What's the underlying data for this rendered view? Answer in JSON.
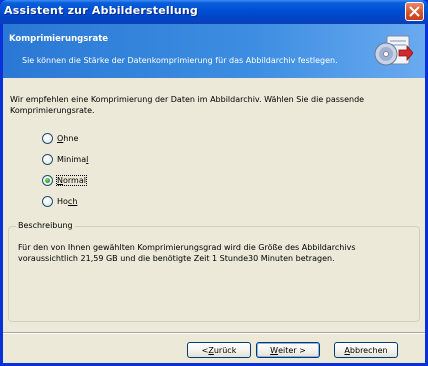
{
  "window": {
    "title": "Assistent zur Abbilderstellung"
  },
  "header": {
    "title": "Komprimierungsrate",
    "subtitle": "Sie können die Stärke der Datenkomprimierung für das Abbildarchiv festlegen.",
    "icon": "disc-archive-icon"
  },
  "intro": {
    "line1": "Wir empfehlen eine Komprimierung der Daten im Abbildarchiv. Wählen Sie die passende",
    "line2": "Komprimierungsrate."
  },
  "compression_options": [
    {
      "label_first": "O",
      "label_rest": "hne",
      "checked": false
    },
    {
      "label_first": "Minima",
      "label_rest": "l",
      "checked": false
    },
    {
      "label_first": "N",
      "label_rest": "ormal",
      "checked": true
    },
    {
      "label_first": "Ho",
      "label_rest": "ch",
      "checked": false
    }
  ],
  "description": {
    "legend": "Beschreibung",
    "line1": "Für den von Ihnen gewählten Komprimierungsgrad wird die Größe des Abbildarchivs",
    "line2": "voraussichtlich 21,59 GB und die benötigte Zeit 1 Stunde30 Minuten betragen."
  },
  "buttons": {
    "back_prefix": "< ",
    "back_accel": "Z",
    "back_rest": "urück",
    "next_accel": "W",
    "next_rest": "eiter >",
    "cancel_accel": "A",
    "cancel_rest": "bbrechen"
  },
  "colors": {
    "titlebar": "#0050d6",
    "header": "#3d8ee2",
    "dialog_bg": "#ece9d8",
    "close_button": "#d4502a",
    "radio_checked": "#21a121"
  }
}
